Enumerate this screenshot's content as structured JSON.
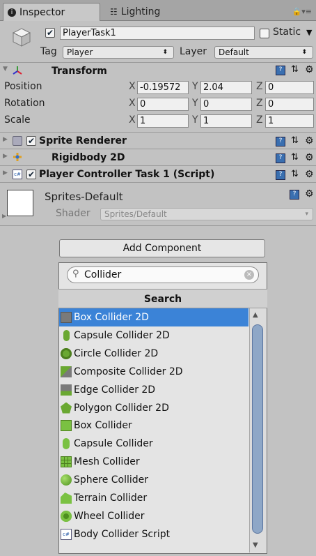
{
  "tabs": {
    "inspector": "Inspector",
    "lighting": "Lighting"
  },
  "header": {
    "object_name": "PlayerTask1",
    "static_label": "Static",
    "tag_label": "Tag",
    "tag_value": "Player",
    "layer_label": "Layer",
    "layer_value": "Default"
  },
  "transform": {
    "title": "Transform",
    "position_label": "Position",
    "rotation_label": "Rotation",
    "scale_label": "Scale",
    "position": {
      "x": "-0.19572",
      "y": "2.04",
      "z": "0"
    },
    "rotation": {
      "x": "0",
      "y": "0",
      "z": "0"
    },
    "scale": {
      "x": "1",
      "y": "1",
      "z": "1"
    }
  },
  "axis": {
    "x": "X",
    "y": "Y",
    "z": "Z"
  },
  "components": {
    "sprite_renderer": "Sprite Renderer",
    "rigidbody": "Rigidbody 2D",
    "player_controller": "Player Controller Task 1 (Script)"
  },
  "material": {
    "name": "Sprites-Default",
    "shader_label": "Shader",
    "shader_value": "Sprites/Default"
  },
  "add_component": {
    "label": "Add Component",
    "search_value": "Collider",
    "search_header": "Search"
  },
  "results": [
    "Box Collider 2D",
    "Capsule Collider 2D",
    "Circle Collider 2D",
    "Composite Collider 2D",
    "Edge Collider 2D",
    "Polygon Collider 2D",
    "Box Collider",
    "Capsule Collider",
    "Mesh Collider",
    "Sphere Collider",
    "Terrain Collider",
    "Wheel Collider",
    "Body Collider Script"
  ],
  "icons": [
    "box-collider-2d-icon",
    "capsule-collider-2d-icon",
    "circle-collider-2d-icon",
    "composite-collider-2d-icon",
    "edge-collider-2d-icon",
    "polygon-collider-2d-icon",
    "box-collider-icon",
    "capsule-collider-icon",
    "mesh-collider-icon",
    "sphere-collider-icon",
    "terrain-collider-icon",
    "wheel-collider-icon",
    "script-icon"
  ],
  "colors": {
    "selection": "#3b83d7",
    "panel_bg": "#c2c2c2"
  }
}
